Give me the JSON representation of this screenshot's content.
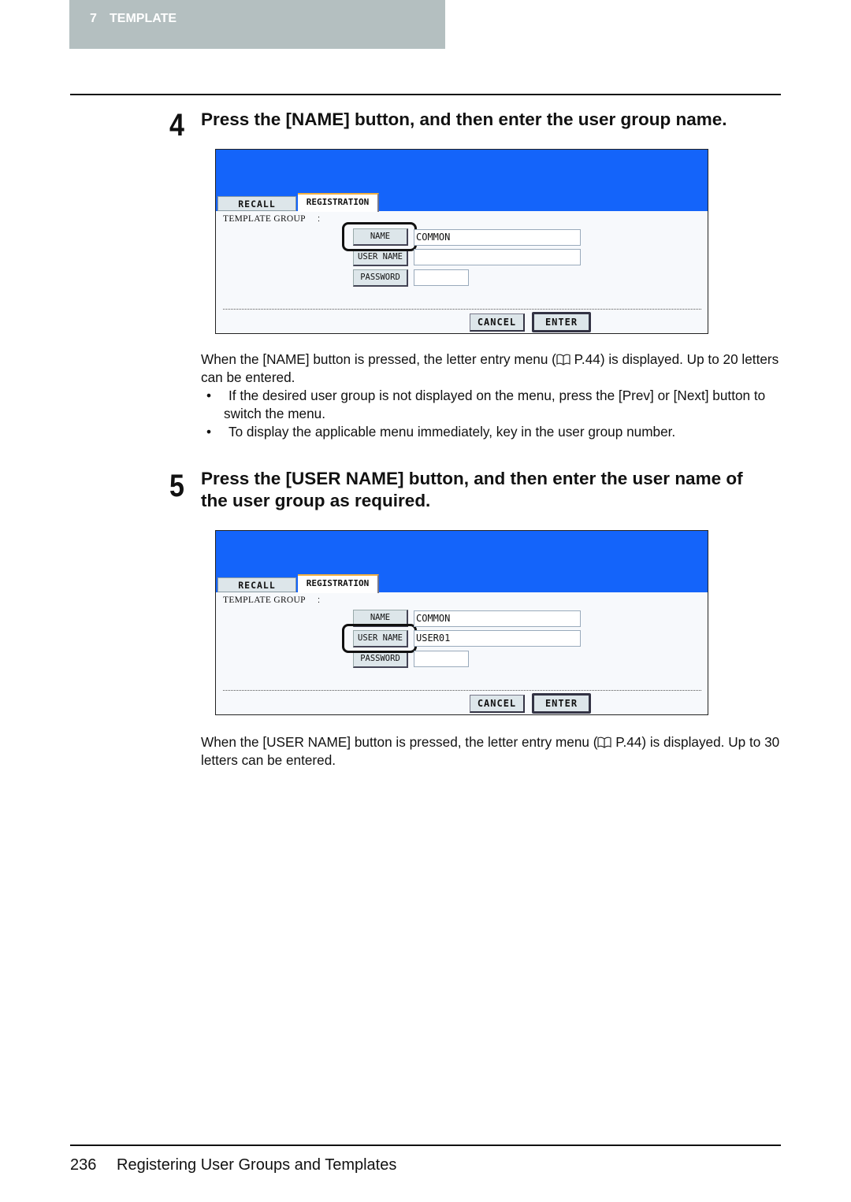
{
  "header": {
    "chapter_number": "7",
    "chapter_title": "TEMPLATE"
  },
  "steps": [
    {
      "number": "4",
      "heading": "Press the [NAME] button, and then enter the user group name.",
      "screen": {
        "tabs": [
          "RECALL",
          "REGISTRATION"
        ],
        "label": "TEMPLATE GROUP",
        "colon": ":",
        "buttons": [
          "NAME",
          "USER NAME",
          "PASSWORD"
        ],
        "fields": [
          "COMMON",
          "",
          ""
        ],
        "highlighted": "NAME",
        "cancel": "CANCEL",
        "enter": "ENTER"
      },
      "text_before_ref": "When the [NAME] button is pressed, the letter entry menu (",
      "text_after_ref": " P.44) is displayed. Up to 20 letters can be entered.",
      "bullets": [
        "If the desired user group is not displayed on the menu, press the [Prev] or [Next] button to switch the menu.",
        "To display the applicable menu immediately, key in the user group number."
      ]
    },
    {
      "number": "5",
      "heading": "Press the [USER NAME] button, and then enter the user name of the user group as required.",
      "screen": {
        "tabs": [
          "RECALL",
          "REGISTRATION"
        ],
        "label": "TEMPLATE GROUP",
        "colon": ":",
        "buttons": [
          "NAME",
          "USER NAME",
          "PASSWORD"
        ],
        "fields": [
          "COMMON",
          "USER01",
          ""
        ],
        "highlighted": "USER NAME",
        "cancel": "CANCEL",
        "enter": "ENTER"
      },
      "text_before_ref": "When the [USER NAME] button is pressed, the letter entry menu (",
      "text_after_ref": " P.44) is displayed. Up to 30 letters can be entered."
    }
  ],
  "icons": {
    "reference": "book-icon"
  },
  "footer": {
    "page_number": "236",
    "title": "Registering User Groups and Templates"
  }
}
